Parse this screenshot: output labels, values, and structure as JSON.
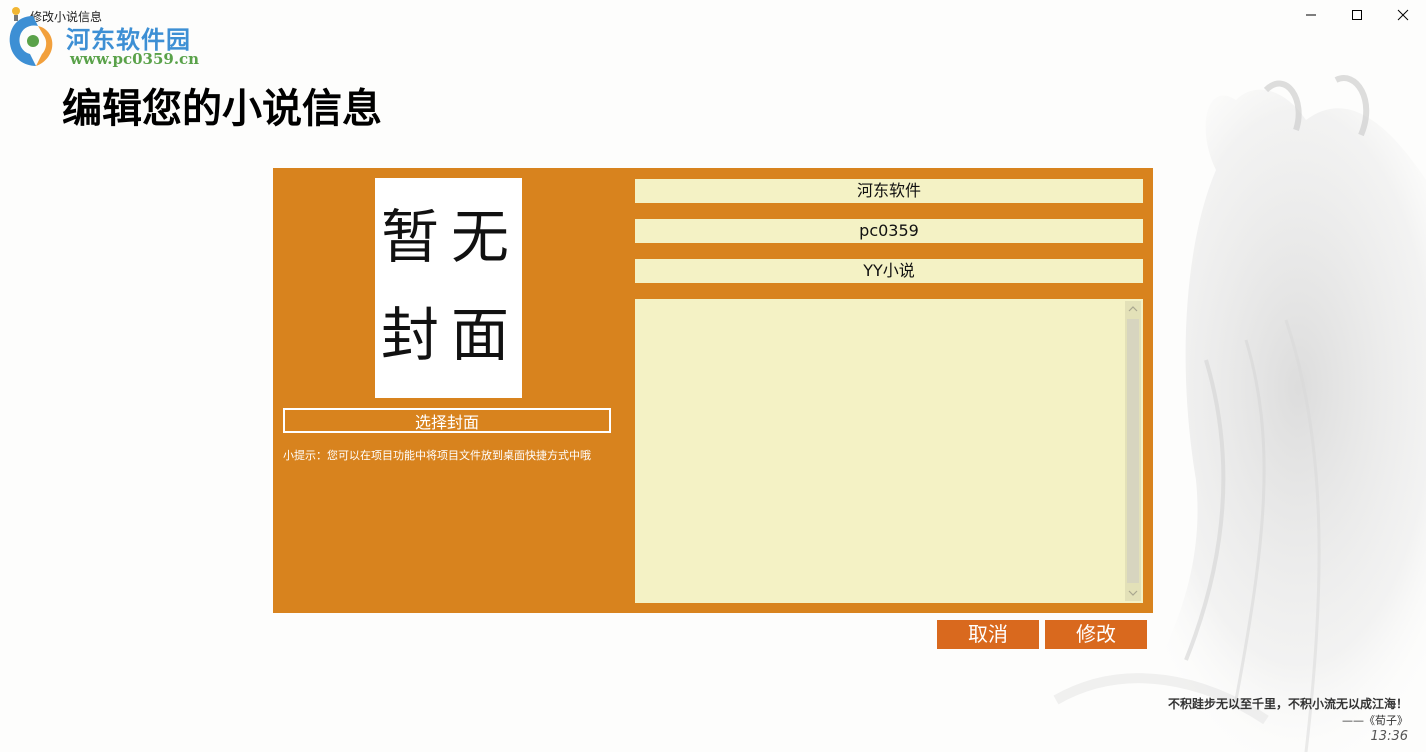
{
  "window": {
    "title": "修改小说信息"
  },
  "watermark": {
    "name": "河东软件园",
    "url": "www.pc0359.cn"
  },
  "page": {
    "title": "编辑您的小说信息"
  },
  "cover": {
    "placeholder_chars": [
      "暂",
      "无",
      "封",
      "面"
    ],
    "choose_label": "选择封面",
    "hint": "小提示：您可以在项目功能中将项目文件放到桌面快捷方式中哦"
  },
  "form": {
    "name": "河东软件",
    "author": "pc0359",
    "category": "YY小说",
    "description": ""
  },
  "actions": {
    "cancel_label": "取消",
    "modify_label": "修改"
  },
  "footer": {
    "quote": "不积跬步无以至千里，不积小流无以成江海！",
    "source": "——《荀子》",
    "time": "13:36"
  },
  "colors": {
    "panel": "#d8831e",
    "field": "#f4f2c5",
    "button": "#d9691e"
  }
}
